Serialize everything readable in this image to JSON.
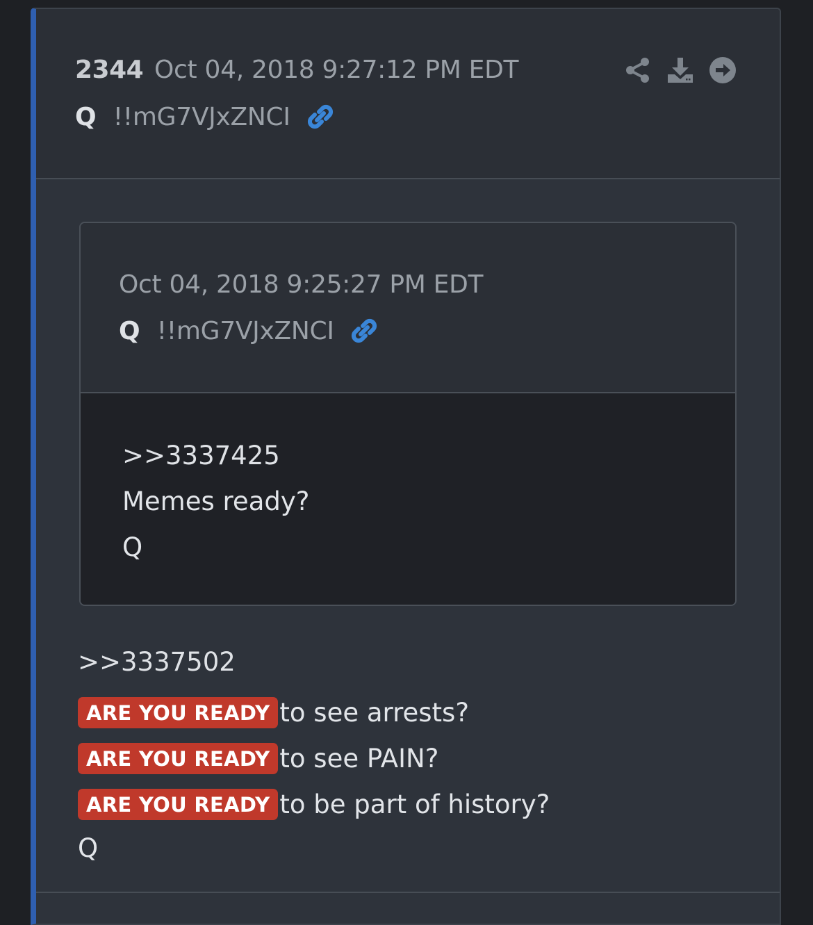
{
  "post": {
    "number": "2344",
    "timestamp": "Oct 04, 2018 9:27:12 PM EDT",
    "author": "Q",
    "tripcode": "!!mG7VJxZNCI",
    "actions": [
      "share-icon",
      "download-icon",
      "arrow-right-circle-icon"
    ],
    "body": {
      "reference": ">>3337502",
      "lines": [
        {
          "badge": "ARE YOU READY",
          "text": "to see arrests?"
        },
        {
          "badge": "ARE YOU READY",
          "text": "to see PAIN?"
        },
        {
          "badge": "ARE YOU READY",
          "text": "to be part of history?"
        }
      ],
      "signature": "Q"
    }
  },
  "quoted_post": {
    "timestamp": "Oct 04, 2018 9:25:27 PM EDT",
    "author": "Q",
    "tripcode": "!!mG7VJxZNCI",
    "body": {
      "reference": ">>3337425",
      "message": "Memes ready?",
      "signature": "Q"
    }
  },
  "colors": {
    "accent_border": "#2f5fb0",
    "badge": "#c0392b",
    "link_icon": "#3a86d8"
  }
}
